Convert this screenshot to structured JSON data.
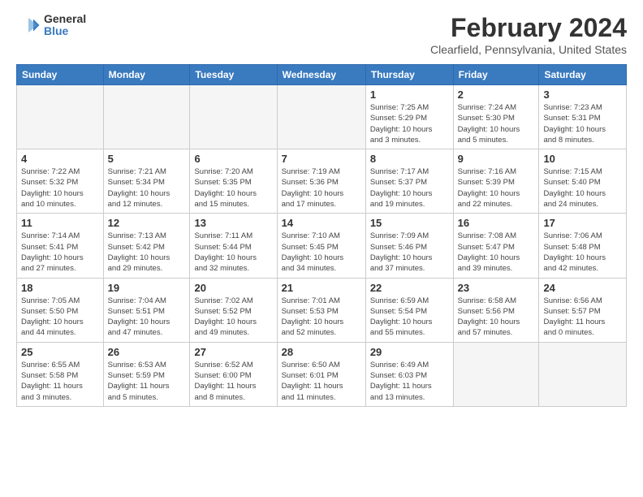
{
  "header": {
    "logo_general": "General",
    "logo_blue": "Blue",
    "month_title": "February 2024",
    "location": "Clearfield, Pennsylvania, United States"
  },
  "weekdays": [
    "Sunday",
    "Monday",
    "Tuesday",
    "Wednesday",
    "Thursday",
    "Friday",
    "Saturday"
  ],
  "weeks": [
    [
      {
        "day": "",
        "info": ""
      },
      {
        "day": "",
        "info": ""
      },
      {
        "day": "",
        "info": ""
      },
      {
        "day": "",
        "info": ""
      },
      {
        "day": "1",
        "info": "Sunrise: 7:25 AM\nSunset: 5:29 PM\nDaylight: 10 hours\nand 3 minutes."
      },
      {
        "day": "2",
        "info": "Sunrise: 7:24 AM\nSunset: 5:30 PM\nDaylight: 10 hours\nand 5 minutes."
      },
      {
        "day": "3",
        "info": "Sunrise: 7:23 AM\nSunset: 5:31 PM\nDaylight: 10 hours\nand 8 minutes."
      }
    ],
    [
      {
        "day": "4",
        "info": "Sunrise: 7:22 AM\nSunset: 5:32 PM\nDaylight: 10 hours\nand 10 minutes."
      },
      {
        "day": "5",
        "info": "Sunrise: 7:21 AM\nSunset: 5:34 PM\nDaylight: 10 hours\nand 12 minutes."
      },
      {
        "day": "6",
        "info": "Sunrise: 7:20 AM\nSunset: 5:35 PM\nDaylight: 10 hours\nand 15 minutes."
      },
      {
        "day": "7",
        "info": "Sunrise: 7:19 AM\nSunset: 5:36 PM\nDaylight: 10 hours\nand 17 minutes."
      },
      {
        "day": "8",
        "info": "Sunrise: 7:17 AM\nSunset: 5:37 PM\nDaylight: 10 hours\nand 19 minutes."
      },
      {
        "day": "9",
        "info": "Sunrise: 7:16 AM\nSunset: 5:39 PM\nDaylight: 10 hours\nand 22 minutes."
      },
      {
        "day": "10",
        "info": "Sunrise: 7:15 AM\nSunset: 5:40 PM\nDaylight: 10 hours\nand 24 minutes."
      }
    ],
    [
      {
        "day": "11",
        "info": "Sunrise: 7:14 AM\nSunset: 5:41 PM\nDaylight: 10 hours\nand 27 minutes."
      },
      {
        "day": "12",
        "info": "Sunrise: 7:13 AM\nSunset: 5:42 PM\nDaylight: 10 hours\nand 29 minutes."
      },
      {
        "day": "13",
        "info": "Sunrise: 7:11 AM\nSunset: 5:44 PM\nDaylight: 10 hours\nand 32 minutes."
      },
      {
        "day": "14",
        "info": "Sunrise: 7:10 AM\nSunset: 5:45 PM\nDaylight: 10 hours\nand 34 minutes."
      },
      {
        "day": "15",
        "info": "Sunrise: 7:09 AM\nSunset: 5:46 PM\nDaylight: 10 hours\nand 37 minutes."
      },
      {
        "day": "16",
        "info": "Sunrise: 7:08 AM\nSunset: 5:47 PM\nDaylight: 10 hours\nand 39 minutes."
      },
      {
        "day": "17",
        "info": "Sunrise: 7:06 AM\nSunset: 5:48 PM\nDaylight: 10 hours\nand 42 minutes."
      }
    ],
    [
      {
        "day": "18",
        "info": "Sunrise: 7:05 AM\nSunset: 5:50 PM\nDaylight: 10 hours\nand 44 minutes."
      },
      {
        "day": "19",
        "info": "Sunrise: 7:04 AM\nSunset: 5:51 PM\nDaylight: 10 hours\nand 47 minutes."
      },
      {
        "day": "20",
        "info": "Sunrise: 7:02 AM\nSunset: 5:52 PM\nDaylight: 10 hours\nand 49 minutes."
      },
      {
        "day": "21",
        "info": "Sunrise: 7:01 AM\nSunset: 5:53 PM\nDaylight: 10 hours\nand 52 minutes."
      },
      {
        "day": "22",
        "info": "Sunrise: 6:59 AM\nSunset: 5:54 PM\nDaylight: 10 hours\nand 55 minutes."
      },
      {
        "day": "23",
        "info": "Sunrise: 6:58 AM\nSunset: 5:56 PM\nDaylight: 10 hours\nand 57 minutes."
      },
      {
        "day": "24",
        "info": "Sunrise: 6:56 AM\nSunset: 5:57 PM\nDaylight: 11 hours\nand 0 minutes."
      }
    ],
    [
      {
        "day": "25",
        "info": "Sunrise: 6:55 AM\nSunset: 5:58 PM\nDaylight: 11 hours\nand 3 minutes."
      },
      {
        "day": "26",
        "info": "Sunrise: 6:53 AM\nSunset: 5:59 PM\nDaylight: 11 hours\nand 5 minutes."
      },
      {
        "day": "27",
        "info": "Sunrise: 6:52 AM\nSunset: 6:00 PM\nDaylight: 11 hours\nand 8 minutes."
      },
      {
        "day": "28",
        "info": "Sunrise: 6:50 AM\nSunset: 6:01 PM\nDaylight: 11 hours\nand 11 minutes."
      },
      {
        "day": "29",
        "info": "Sunrise: 6:49 AM\nSunset: 6:03 PM\nDaylight: 11 hours\nand 13 minutes."
      },
      {
        "day": "",
        "info": ""
      },
      {
        "day": "",
        "info": ""
      }
    ]
  ]
}
